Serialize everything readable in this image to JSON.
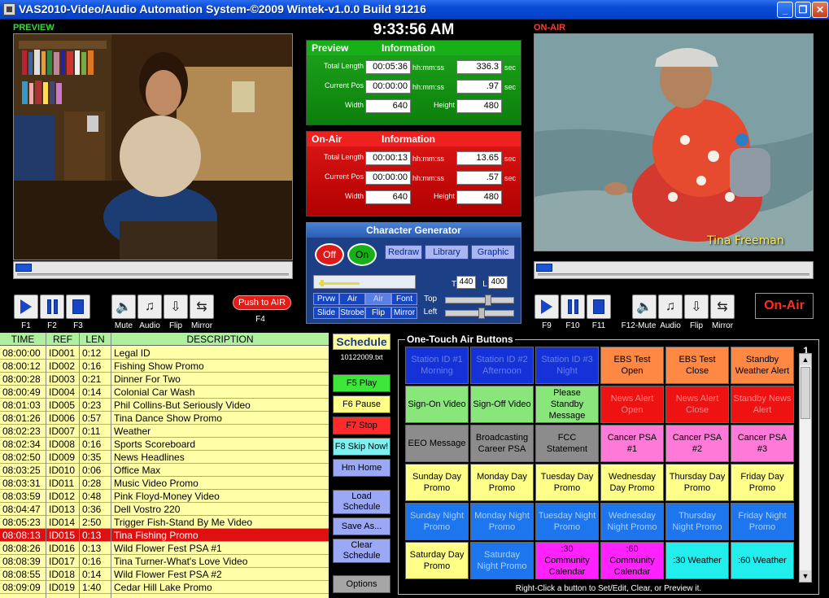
{
  "window": {
    "title": "VAS2010-Video/Audio Automation System-©2009 Wintek-v1.0.0 Build 91216"
  },
  "labels": {
    "preview": "PREVIEW",
    "on_air": "ON-AIR"
  },
  "clock": "9:33:56 AM",
  "colors": {
    "preview": "#18b018",
    "on_air": "#ee2020",
    "accent": "#1645c8"
  },
  "preview_info": {
    "header_a": "Preview",
    "header_b": "Information",
    "total_length_label": "Total Length",
    "total_length": "00:05:36",
    "total_length_unit": "hh:mm:ss",
    "total_sec": "336.3",
    "sec_unit": "sec",
    "current_pos_label": "Current Pos",
    "current_pos": "00:00:00",
    "current_pos_unit": "hh:mm:ss",
    "current_sec": ".97",
    "width_label": "Width",
    "width": "640",
    "height_label": "Height",
    "height": "480"
  },
  "onair_info": {
    "header_a": "On-Air",
    "header_b": "Information",
    "total_length_label": "Total Length",
    "total_length": "00:00:13",
    "total_length_unit": "hh:mm:ss",
    "total_sec": "13.65",
    "sec_unit": "sec",
    "current_pos_label": "Current Pos",
    "current_pos": "00:00:00",
    "current_pos_unit": "hh:mm:ss",
    "current_sec": ".57",
    "width_label": "Width",
    "width": "640",
    "height_label": "Height",
    "height": "480"
  },
  "chargen": {
    "title": "Character Generator",
    "off": "Off",
    "on": "On",
    "redraw": "Redraw",
    "library": "Library",
    "graphic": "Graphic",
    "prvw": "Prvw",
    "air": "Air",
    "air2": "Air",
    "font": "Font",
    "slide": "Slide",
    "strobe": "Strobe",
    "flip": "Flip",
    "mirror": "Mirror",
    "top_label": "Top",
    "left_label": "Left",
    "t_label": "T",
    "l_label": "L",
    "t_value": "440",
    "l_value": "400"
  },
  "preview_controls": {
    "f1": "F1",
    "f2": "F2",
    "f3": "F3",
    "f4": "F4",
    "mute": "Mute",
    "audio": "Audio",
    "flip": "Flip",
    "mirror": "Mirror",
    "push_to_air": "Push to AIR"
  },
  "onair_controls": {
    "f9": "F9",
    "f10": "F10",
    "f11": "F11",
    "mute": "F12-Mute",
    "audio": "Audio",
    "flip": "Flip",
    "mirror": "Mirror",
    "badge": "On-Air"
  },
  "onair_caption": "Tina Freeman",
  "schedule": {
    "headers": {
      "time": "TIME",
      "ref": "REF",
      "len": "LEN",
      "desc": "DESCRIPTION"
    },
    "rows": [
      {
        "time": "08:00:00",
        "ref": "ID001",
        "len": "0:12",
        "desc": "Legal ID"
      },
      {
        "time": "08:00:12",
        "ref": "ID002",
        "len": "0:16",
        "desc": "Fishing Show Promo"
      },
      {
        "time": "08:00:28",
        "ref": "ID003",
        "len": "0:21",
        "desc": "Dinner For Two"
      },
      {
        "time": "08:00:49",
        "ref": "ID004",
        "len": "0:14",
        "desc": "Colonial Car Wash"
      },
      {
        "time": "08:01:03",
        "ref": "ID005",
        "len": "0:23",
        "desc": "Phil Collins-But Seriously Video"
      },
      {
        "time": "08:01:26",
        "ref": "ID006",
        "len": "0:57",
        "desc": "Tina Dance Show Promo"
      },
      {
        "time": "08:02:23",
        "ref": "ID007",
        "len": "0:11",
        "desc": "Weather"
      },
      {
        "time": "08:02:34",
        "ref": "ID008",
        "len": "0:16",
        "desc": "Sports Scoreboard"
      },
      {
        "time": "08:02:50",
        "ref": "ID009",
        "len": "0:35",
        "desc": "News Headlines"
      },
      {
        "time": "08:03:25",
        "ref": "ID010",
        "len": "0:06",
        "desc": "Office Max"
      },
      {
        "time": "08:03:31",
        "ref": "ID011",
        "len": "0:28",
        "desc": "Music Video Promo"
      },
      {
        "time": "08:03:59",
        "ref": "ID012",
        "len": "0:48",
        "desc": "Pink Floyd-Money Video"
      },
      {
        "time": "08:04:47",
        "ref": "ID013",
        "len": "0:36",
        "desc": "Dell Vostro 220"
      },
      {
        "time": "08:05:23",
        "ref": "ID014",
        "len": "2:50",
        "desc": "Trigger Fish-Stand By Me Video"
      },
      {
        "time": "08:08:13",
        "ref": "ID015",
        "len": "0:13",
        "desc": "Tina Fishing Promo",
        "active": true
      },
      {
        "time": "08:08:26",
        "ref": "ID016",
        "len": "0:13",
        "desc": "Wild Flower Fest PSA #1"
      },
      {
        "time": "08:08:39",
        "ref": "ID017",
        "len": "0:16",
        "desc": "Tina Turner-What's Love Video"
      },
      {
        "time": "08:08:55",
        "ref": "ID018",
        "len": "0:14",
        "desc": "Wild Flower Fest PSA #2"
      },
      {
        "time": "08:09:09",
        "ref": "ID019",
        "len": "1:40",
        "desc": "Cedar Hill Lake Promo"
      }
    ]
  },
  "schedule_side": {
    "title": "Schedule",
    "file": "10122009.txt",
    "play": "F5 Play",
    "pause": "F6 Pause",
    "stop": "F7 Stop",
    "skip": "F8 Skip Now!",
    "home": "Hm Home",
    "load": "Load Schedule",
    "save_as": "Save As...",
    "clear": "Clear Schedule",
    "options": "Options"
  },
  "one_touch": {
    "title": "One-Touch Air Buttons",
    "page": "1",
    "footer": "Right-Click a button to Set/Edit, Clear, or Preview it.",
    "buttons": [
      {
        "label": "Station ID #1 Morning",
        "color": "#1432d8",
        "fg": "#6a7fe6"
      },
      {
        "label": "Station ID #2 Afternoon",
        "color": "#1432d8",
        "fg": "#6a7fe6"
      },
      {
        "label": "Station ID #3 Night",
        "color": "#1432d8",
        "fg": "#6a7fe6"
      },
      {
        "label": "EBS Test Open",
        "color": "#ff8844",
        "fg": "#000000"
      },
      {
        "label": "EBS Test Close",
        "color": "#ff8844",
        "fg": "#000000"
      },
      {
        "label": "Standby Weather Alert",
        "color": "#ff8844",
        "fg": "#000000"
      },
      {
        "label": "Sign-On Video",
        "color": "#88e67a",
        "fg": "#000000"
      },
      {
        "label": "Sign-Off Video",
        "color": "#88e67a",
        "fg": "#000000"
      },
      {
        "label": "Please Standby Message",
        "color": "#88e67a",
        "fg": "#000000"
      },
      {
        "label": "News Alert Open",
        "color": "#ee1212",
        "fg": "#ff8a8a"
      },
      {
        "label": "News Alert Close",
        "color": "#ee1212",
        "fg": "#ff8a8a"
      },
      {
        "label": "Standby News Alert",
        "color": "#ee1212",
        "fg": "#ff8a8a"
      },
      {
        "label": "EEO Message",
        "color": "#8c8c8c",
        "fg": "#000000"
      },
      {
        "label": "Broadcasting Career PSA",
        "color": "#8c8c8c",
        "fg": "#000000"
      },
      {
        "label": "FCC Statement",
        "color": "#8c8c8c",
        "fg": "#000000"
      },
      {
        "label": "Cancer PSA #1",
        "color": "#ff7ad8",
        "fg": "#000000"
      },
      {
        "label": "Cancer PSA #2",
        "color": "#ff7ad8",
        "fg": "#000000"
      },
      {
        "label": "Cancer PSA #3",
        "color": "#ff7ad8",
        "fg": "#000000"
      },
      {
        "label": "Sunday Day Promo",
        "color": "#ffff88",
        "fg": "#000000"
      },
      {
        "label": "Monday Day Promo",
        "color": "#ffff88",
        "fg": "#000000"
      },
      {
        "label": "Tuesday Day Promo",
        "color": "#ffff88",
        "fg": "#000000"
      },
      {
        "label": "Wednesday Day Promo",
        "color": "#ffff88",
        "fg": "#000000"
      },
      {
        "label": "Thursday Day Promo",
        "color": "#ffff88",
        "fg": "#000000"
      },
      {
        "label": "Friday Day Promo",
        "color": "#ffff88",
        "fg": "#000000"
      },
      {
        "label": "Sunday Night Promo",
        "color": "#1e76ee",
        "fg": "#a8d0ff"
      },
      {
        "label": "Monday Night Promo",
        "color": "#1e76ee",
        "fg": "#a8d0ff"
      },
      {
        "label": "Tuesday Night Promo",
        "color": "#1e76ee",
        "fg": "#a8d0ff"
      },
      {
        "label": "Wednesday Night Promo",
        "color": "#1e76ee",
        "fg": "#a8d0ff"
      },
      {
        "label": "Thursday Night Promo",
        "color": "#1e76ee",
        "fg": "#a8d0ff"
      },
      {
        "label": "Friday Night Promo",
        "color": "#1e76ee",
        "fg": "#a8d0ff"
      },
      {
        "label": "Saturday Day Promo",
        "color": "#ffff88",
        "fg": "#000000"
      },
      {
        "label": "Saturday Night Promo",
        "color": "#1e76ee",
        "fg": "#a8d0ff"
      },
      {
        "label": ":30 Community Calendar",
        "color": "#ff22ff",
        "fg": "#000000"
      },
      {
        "label": ":60 Community Calendar",
        "color": "#ff22ff",
        "fg": "#000000"
      },
      {
        "label": ":30 Weather",
        "color": "#22eeee",
        "fg": "#000000"
      },
      {
        "label": ":60 Weather",
        "color": "#22eeee",
        "fg": "#000000"
      }
    ]
  }
}
